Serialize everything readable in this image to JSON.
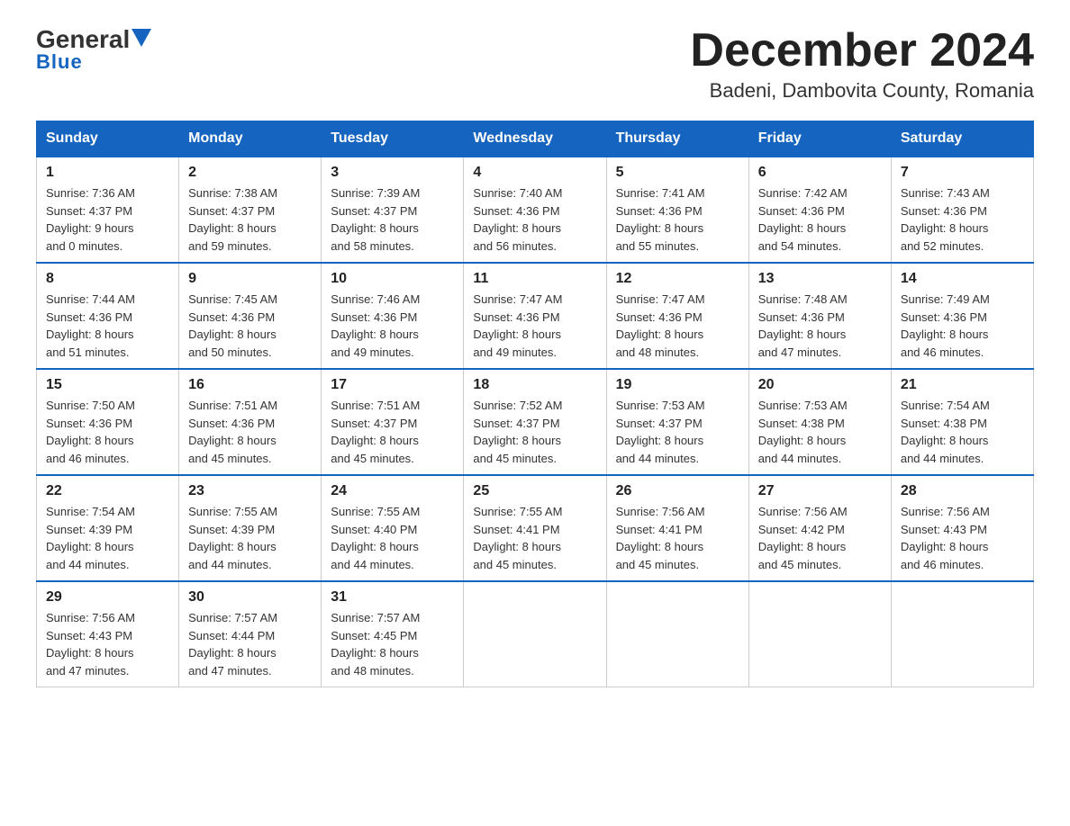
{
  "header": {
    "logo_general": "General",
    "logo_blue": "Blue",
    "month_year": "December 2024",
    "location": "Badeni, Dambovita County, Romania"
  },
  "days_of_week": [
    "Sunday",
    "Monday",
    "Tuesday",
    "Wednesday",
    "Thursday",
    "Friday",
    "Saturday"
  ],
  "weeks": [
    [
      {
        "day": "1",
        "sunrise": "7:36 AM",
        "sunset": "4:37 PM",
        "daylight": "9 hours and 0 minutes."
      },
      {
        "day": "2",
        "sunrise": "7:38 AM",
        "sunset": "4:37 PM",
        "daylight": "8 hours and 59 minutes."
      },
      {
        "day": "3",
        "sunrise": "7:39 AM",
        "sunset": "4:37 PM",
        "daylight": "8 hours and 58 minutes."
      },
      {
        "day": "4",
        "sunrise": "7:40 AM",
        "sunset": "4:36 PM",
        "daylight": "8 hours and 56 minutes."
      },
      {
        "day": "5",
        "sunrise": "7:41 AM",
        "sunset": "4:36 PM",
        "daylight": "8 hours and 55 minutes."
      },
      {
        "day": "6",
        "sunrise": "7:42 AM",
        "sunset": "4:36 PM",
        "daylight": "8 hours and 54 minutes."
      },
      {
        "day": "7",
        "sunrise": "7:43 AM",
        "sunset": "4:36 PM",
        "daylight": "8 hours and 52 minutes."
      }
    ],
    [
      {
        "day": "8",
        "sunrise": "7:44 AM",
        "sunset": "4:36 PM",
        "daylight": "8 hours and 51 minutes."
      },
      {
        "day": "9",
        "sunrise": "7:45 AM",
        "sunset": "4:36 PM",
        "daylight": "8 hours and 50 minutes."
      },
      {
        "day": "10",
        "sunrise": "7:46 AM",
        "sunset": "4:36 PM",
        "daylight": "8 hours and 49 minutes."
      },
      {
        "day": "11",
        "sunrise": "7:47 AM",
        "sunset": "4:36 PM",
        "daylight": "8 hours and 49 minutes."
      },
      {
        "day": "12",
        "sunrise": "7:47 AM",
        "sunset": "4:36 PM",
        "daylight": "8 hours and 48 minutes."
      },
      {
        "day": "13",
        "sunrise": "7:48 AM",
        "sunset": "4:36 PM",
        "daylight": "8 hours and 47 minutes."
      },
      {
        "day": "14",
        "sunrise": "7:49 AM",
        "sunset": "4:36 PM",
        "daylight": "8 hours and 46 minutes."
      }
    ],
    [
      {
        "day": "15",
        "sunrise": "7:50 AM",
        "sunset": "4:36 PM",
        "daylight": "8 hours and 46 minutes."
      },
      {
        "day": "16",
        "sunrise": "7:51 AM",
        "sunset": "4:36 PM",
        "daylight": "8 hours and 45 minutes."
      },
      {
        "day": "17",
        "sunrise": "7:51 AM",
        "sunset": "4:37 PM",
        "daylight": "8 hours and 45 minutes."
      },
      {
        "day": "18",
        "sunrise": "7:52 AM",
        "sunset": "4:37 PM",
        "daylight": "8 hours and 45 minutes."
      },
      {
        "day": "19",
        "sunrise": "7:53 AM",
        "sunset": "4:37 PM",
        "daylight": "8 hours and 44 minutes."
      },
      {
        "day": "20",
        "sunrise": "7:53 AM",
        "sunset": "4:38 PM",
        "daylight": "8 hours and 44 minutes."
      },
      {
        "day": "21",
        "sunrise": "7:54 AM",
        "sunset": "4:38 PM",
        "daylight": "8 hours and 44 minutes."
      }
    ],
    [
      {
        "day": "22",
        "sunrise": "7:54 AM",
        "sunset": "4:39 PM",
        "daylight": "8 hours and 44 minutes."
      },
      {
        "day": "23",
        "sunrise": "7:55 AM",
        "sunset": "4:39 PM",
        "daylight": "8 hours and 44 minutes."
      },
      {
        "day": "24",
        "sunrise": "7:55 AM",
        "sunset": "4:40 PM",
        "daylight": "8 hours and 44 minutes."
      },
      {
        "day": "25",
        "sunrise": "7:55 AM",
        "sunset": "4:41 PM",
        "daylight": "8 hours and 45 minutes."
      },
      {
        "day": "26",
        "sunrise": "7:56 AM",
        "sunset": "4:41 PM",
        "daylight": "8 hours and 45 minutes."
      },
      {
        "day": "27",
        "sunrise": "7:56 AM",
        "sunset": "4:42 PM",
        "daylight": "8 hours and 45 minutes."
      },
      {
        "day": "28",
        "sunrise": "7:56 AM",
        "sunset": "4:43 PM",
        "daylight": "8 hours and 46 minutes."
      }
    ],
    [
      {
        "day": "29",
        "sunrise": "7:56 AM",
        "sunset": "4:43 PM",
        "daylight": "8 hours and 47 minutes."
      },
      {
        "day": "30",
        "sunrise": "7:57 AM",
        "sunset": "4:44 PM",
        "daylight": "8 hours and 47 minutes."
      },
      {
        "day": "31",
        "sunrise": "7:57 AM",
        "sunset": "4:45 PM",
        "daylight": "8 hours and 48 minutes."
      },
      null,
      null,
      null,
      null
    ]
  ]
}
